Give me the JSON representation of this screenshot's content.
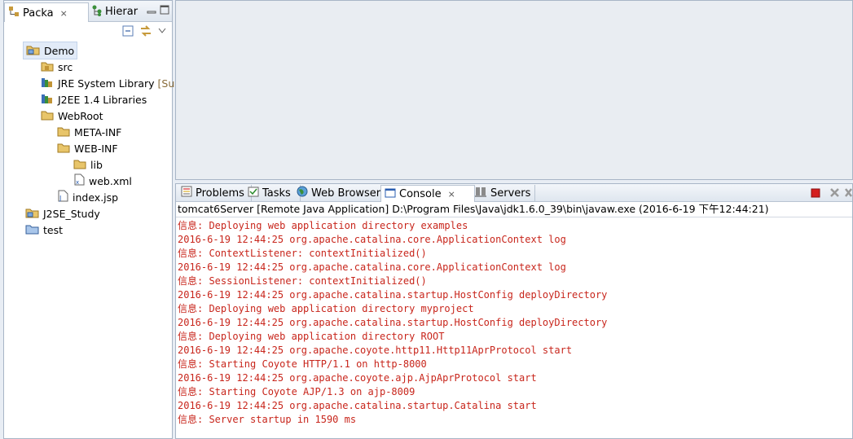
{
  "left_view": {
    "tabs": [
      {
        "label": "Packa",
        "close": "⨯"
      },
      {
        "label": "Hierar"
      }
    ],
    "tree": [
      {
        "label": "Demo",
        "icon": "project-icon",
        "selected": true
      },
      {
        "label": "src",
        "icon": "source-folder-icon"
      },
      {
        "label": "JRE System Library",
        "suffix": "[Sun",
        "icon": "library-icon"
      },
      {
        "label": "J2EE 1.4 Libraries",
        "icon": "library-icon"
      },
      {
        "label": "WebRoot",
        "icon": "folder-icon"
      },
      {
        "label": "META-INF",
        "icon": "folder-icon"
      },
      {
        "label": "WEB-INF",
        "icon": "folder-icon"
      },
      {
        "label": "lib",
        "icon": "folder-icon"
      },
      {
        "label": "web.xml",
        "icon": "xml-file-icon"
      },
      {
        "label": "index.jsp",
        "icon": "jsp-file-icon"
      },
      {
        "label": "J2SE_Study",
        "icon": "project-icon"
      },
      {
        "label": "test",
        "icon": "closed-project-icon"
      }
    ]
  },
  "console_view": {
    "tabs": [
      {
        "label": "Problems",
        "icon": "problems-icon"
      },
      {
        "label": "Tasks",
        "icon": "tasks-icon"
      },
      {
        "label": "Web Browser",
        "icon": "globe-icon"
      },
      {
        "label": "Console",
        "icon": "console-icon",
        "close": "⨯",
        "active": true
      },
      {
        "label": "Servers",
        "icon": "servers-icon"
      }
    ],
    "title": "tomcat6Server [Remote Java Application] D:\\Program Files\\Java\\jdk1.6.0_39\\bin\\javaw.exe (2016-6-19 下午12:44:21)",
    "lines": [
      "信息: Deploying web application directory examples",
      "2016-6-19 12:44:25 org.apache.catalina.core.ApplicationContext log",
      "信息: ContextListener: contextInitialized()",
      "2016-6-19 12:44:25 org.apache.catalina.core.ApplicationContext log",
      "信息: SessionListener: contextInitialized()",
      "2016-6-19 12:44:25 org.apache.catalina.startup.HostConfig deployDirectory",
      "信息: Deploying web application directory myproject",
      "2016-6-19 12:44:25 org.apache.catalina.startup.HostConfig deployDirectory",
      "信息: Deploying web application directory ROOT",
      "2016-6-19 12:44:25 org.apache.coyote.http11.Http11AprProtocol start",
      "信息: Starting Coyote HTTP/1.1 on http-8000",
      "2016-6-19 12:44:25 org.apache.coyote.ajp.AjpAprProtocol start",
      "信息: Starting Coyote AJP/1.3 on ajp-8009",
      "2016-6-19 12:44:25 org.apache.catalina.startup.Catalina start",
      "信息: Server startup in 1590 ms"
    ]
  },
  "colors": {
    "console_text": "#c8261c",
    "terminate": "#d42020"
  }
}
